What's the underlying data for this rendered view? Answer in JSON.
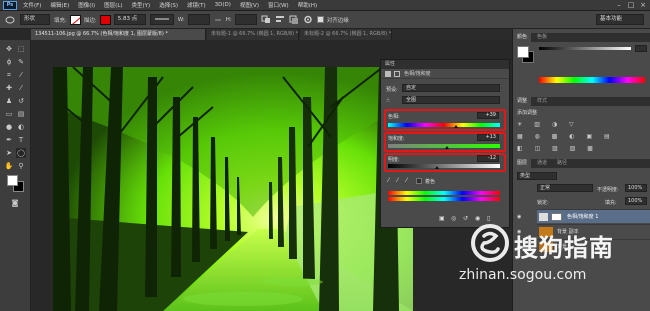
{
  "menubar": {
    "logo": "Ps",
    "items": [
      "文件(F)",
      "编辑(E)",
      "图像(I)",
      "图层(L)",
      "类型(Y)",
      "选择(S)",
      "滤镜(T)",
      "3D(D)",
      "视图(V)",
      "窗口(W)",
      "帮助(H)"
    ]
  },
  "options": {
    "shape_mode": "形状",
    "fill_label": "填充:",
    "stroke_label": "描边:",
    "stroke_width": "5.83 点",
    "w_label": "W:",
    "h_label": "H:",
    "align_edges": "对齐边缘",
    "workspace": "基本功能"
  },
  "tabs": [
    {
      "label": "134511-106.jpg @ 66.7% (色相/饱和度 1, 图层蒙版/8) *",
      "active": true
    },
    {
      "label": "未标题-1 @ 66.7% (椭圆 1, RGB/8) *",
      "active": false
    },
    {
      "label": "未标题-2 @ 66.7% (椭圆 1, RGB/8) *",
      "active": false
    }
  ],
  "properties": {
    "panel_title": "属性",
    "adjustment_name": "色相/饱和度",
    "preset_label": "预设:",
    "preset_value": "自定",
    "channel_value": "全图",
    "hue_label": "色相:",
    "hue_value": "+39",
    "hue_fraction": 0.61,
    "saturation_label": "饱和度:",
    "saturation_value": "+13",
    "saturation_fraction": 0.53,
    "lightness_label": "明度:",
    "lightness_value": "-12",
    "lightness_fraction": 0.44,
    "colorize_label": "着色",
    "highlight_color": "#e21717"
  },
  "right_panel": {
    "color_tabs": [
      "颜色",
      "色板"
    ],
    "adjust_tabs": [
      "调整",
      "样式"
    ],
    "add_adjustment": "添加调整",
    "layer_tabs": [
      "图层",
      "通道",
      "路径"
    ],
    "kind_filter": "类型",
    "blend_mode": "正常",
    "opacity_label": "不透明度:",
    "opacity_value": "100%",
    "lock_label": "锁定:",
    "fill_label": "填充:",
    "fill_value": "100%",
    "layers": [
      {
        "name": "色相/饱和度 1",
        "selected": true
      },
      {
        "name": "背景 副本",
        "selected": false
      },
      {
        "name": "背景",
        "selected": false
      }
    ]
  },
  "watermark": {
    "brand": "搜狗指南",
    "url": "zhinan.sogou.com"
  }
}
